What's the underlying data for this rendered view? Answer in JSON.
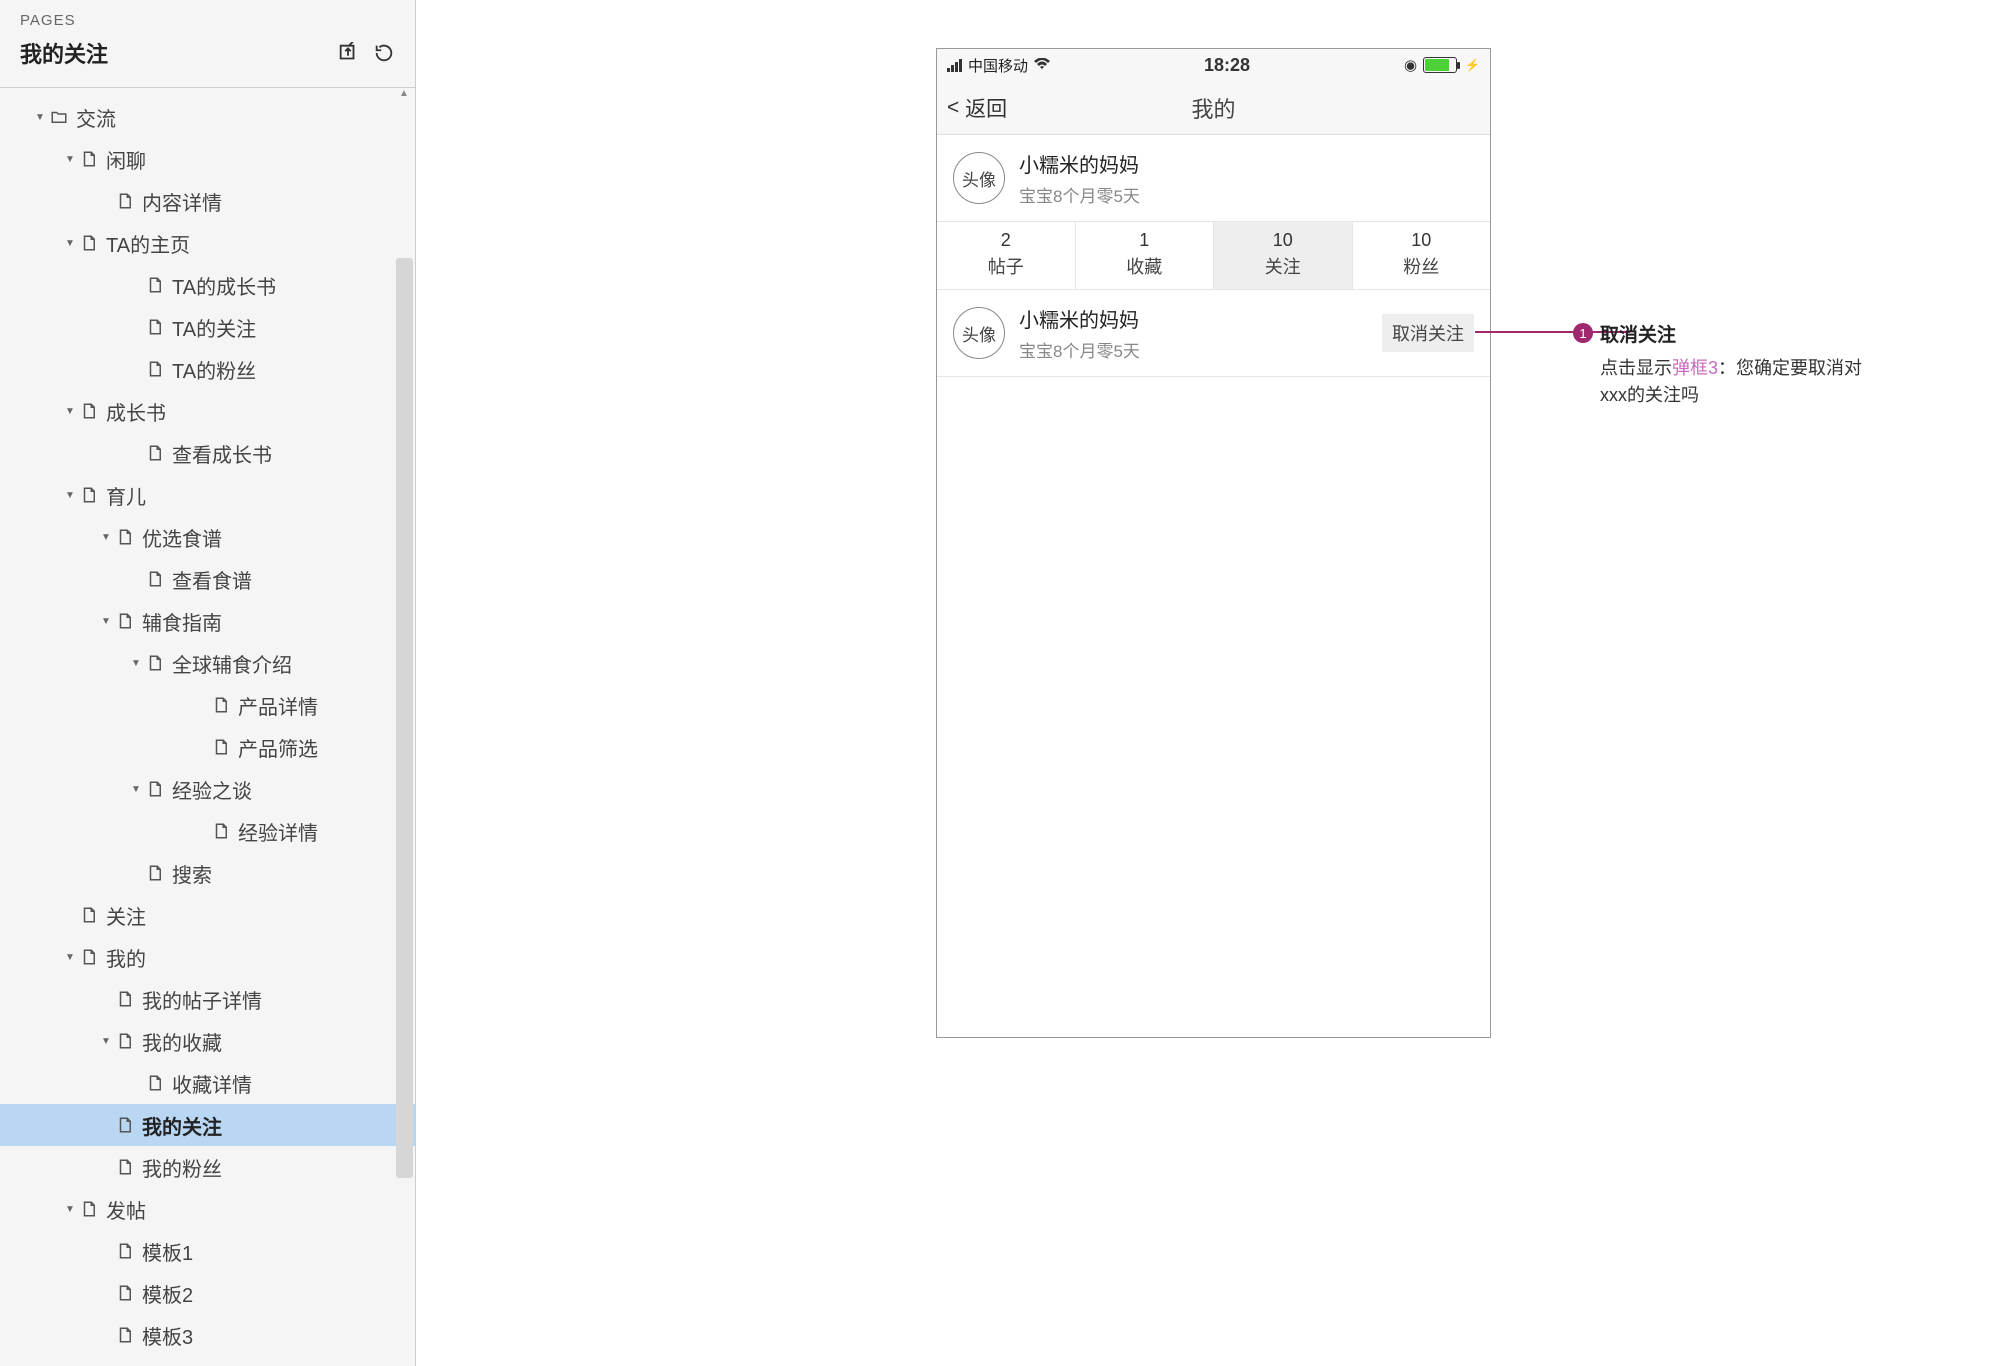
{
  "sidebar": {
    "pages_label": "PAGES",
    "current_page": "我的关注",
    "tree": [
      {
        "indent": 0,
        "chevron": true,
        "open": true,
        "icon": "folder",
        "label": "交流",
        "sel": false
      },
      {
        "indent": 1,
        "chevron": true,
        "open": true,
        "icon": "page",
        "label": "闲聊",
        "sel": false
      },
      {
        "indent": 2,
        "chevron": false,
        "icon": "page",
        "label": "内容详情",
        "sel": false
      },
      {
        "indent": 1,
        "chevron": true,
        "open": true,
        "icon": "page",
        "label": "TA的主页",
        "sel": false
      },
      {
        "indent": 3,
        "chevron": false,
        "icon": "page",
        "label": "TA的成长书",
        "sel": false
      },
      {
        "indent": 3,
        "chevron": false,
        "icon": "page",
        "label": "TA的关注",
        "sel": false
      },
      {
        "indent": 3,
        "chevron": false,
        "icon": "page",
        "label": "TA的粉丝",
        "sel": false
      },
      {
        "indent": 1,
        "chevron": true,
        "open": true,
        "icon": "page",
        "label": "成长书",
        "sel": false
      },
      {
        "indent": 3,
        "chevron": false,
        "icon": "page",
        "label": "查看成长书",
        "sel": false
      },
      {
        "indent": 1,
        "chevron": true,
        "open": true,
        "icon": "page",
        "label": "育儿",
        "sel": false
      },
      {
        "indent": 2,
        "chevron": true,
        "open": true,
        "icon": "page",
        "label": "优选食谱",
        "sel": false
      },
      {
        "indent": 3,
        "chevron": false,
        "icon": "page",
        "label": "查看食谱",
        "sel": false
      },
      {
        "indent": 2,
        "chevron": true,
        "open": true,
        "icon": "page",
        "label": "辅食指南",
        "sel": false
      },
      {
        "indent": 3,
        "chevron": true,
        "open": true,
        "icon": "page",
        "label": "全球辅食介绍",
        "sel": false
      },
      {
        "indent": 5,
        "chevron": false,
        "icon": "page",
        "label": "产品详情",
        "sel": false
      },
      {
        "indent": 5,
        "chevron": false,
        "icon": "page",
        "label": "产品筛选",
        "sel": false
      },
      {
        "indent": 3,
        "chevron": true,
        "open": true,
        "icon": "page",
        "label": "经验之谈",
        "sel": false
      },
      {
        "indent": 5,
        "chevron": false,
        "icon": "page",
        "label": "经验详情",
        "sel": false
      },
      {
        "indent": 3,
        "chevron": false,
        "icon": "page",
        "label": "搜索",
        "sel": false
      },
      {
        "indent": 1,
        "chevron": false,
        "icon": "page",
        "label": "关注",
        "sel": false
      },
      {
        "indent": 1,
        "chevron": true,
        "open": true,
        "icon": "page",
        "label": "我的",
        "sel": false
      },
      {
        "indent": 2,
        "chevron": false,
        "icon": "page",
        "label": "我的帖子详情",
        "sel": false
      },
      {
        "indent": 2,
        "chevron": true,
        "open": true,
        "icon": "page",
        "label": "我的收藏",
        "sel": false
      },
      {
        "indent": 3,
        "chevron": false,
        "icon": "page",
        "label": "收藏详情",
        "sel": false
      },
      {
        "indent": 2,
        "chevron": false,
        "icon": "page",
        "label": "我的关注",
        "sel": true
      },
      {
        "indent": 2,
        "chevron": false,
        "icon": "page",
        "label": "我的粉丝",
        "sel": false
      },
      {
        "indent": 1,
        "chevron": true,
        "open": true,
        "icon": "page",
        "label": "发帖",
        "sel": false
      },
      {
        "indent": 2,
        "chevron": false,
        "icon": "page",
        "label": "模板1",
        "sel": false
      },
      {
        "indent": 2,
        "chevron": false,
        "icon": "page",
        "label": "模板2",
        "sel": false
      },
      {
        "indent": 2,
        "chevron": false,
        "icon": "page",
        "label": "模板3",
        "sel": false
      }
    ]
  },
  "phone": {
    "status": {
      "carrier": "中国移动",
      "time": "18:28"
    },
    "nav": {
      "back": "返回",
      "title": "我的"
    },
    "profile": {
      "avatar_text": "头像",
      "name": "小糯米的妈妈",
      "sub": "宝宝8个月零5天"
    },
    "stats": [
      {
        "number": "2",
        "label": "帖子",
        "active": false
      },
      {
        "number": "1",
        "label": "收藏",
        "active": false
      },
      {
        "number": "10",
        "label": "关注",
        "active": true
      },
      {
        "number": "10",
        "label": "粉丝",
        "active": false
      }
    ],
    "follow": {
      "avatar_text": "头像",
      "name": "小糯米的妈妈",
      "sub": "宝宝8个月零5天",
      "btn": "取消关注"
    }
  },
  "annotation": {
    "badge": "1",
    "title": "取消关注",
    "desc_prefix": "点击显示",
    "desc_link": "弹框3",
    "desc_suffix": "：您确定要取消对xxx的关注吗"
  }
}
